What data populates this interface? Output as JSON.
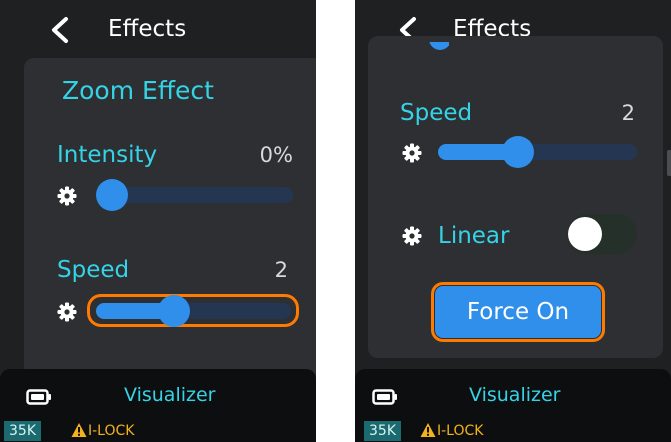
{
  "left_screen": {
    "header": {
      "title": "Effects"
    },
    "card_title": "Zoom Effect",
    "intensity": {
      "label": "Intensity",
      "value": "0%",
      "level": 0.0
    },
    "speed": {
      "label": "Speed",
      "value": "2",
      "level": 0.4
    },
    "footer": {
      "title": "Visualizer",
      "badge": "35K",
      "lock": "I-LOCK"
    }
  },
  "right_screen": {
    "header": {
      "title": "Effects"
    },
    "speed": {
      "label": "Speed",
      "value": "2",
      "level": 0.4
    },
    "linear": {
      "label": "Linear",
      "on": false
    },
    "force_button": "Force On",
    "footer": {
      "title": "Visualizer",
      "badge": "35K",
      "lock": "I-LOCK"
    }
  },
  "icons": {
    "back": "back-icon",
    "gear": "gear-icon",
    "battery": "battery-icon",
    "warning": "warning-icon"
  },
  "colors": {
    "background": "#1f2022",
    "card": "#2d2f33",
    "accent_cyan": "#35d3e6",
    "slider_blue": "#2f8fea",
    "track": "#243652",
    "focus_orange": "#ff7a00",
    "warning_yellow": "#f2b31e"
  }
}
